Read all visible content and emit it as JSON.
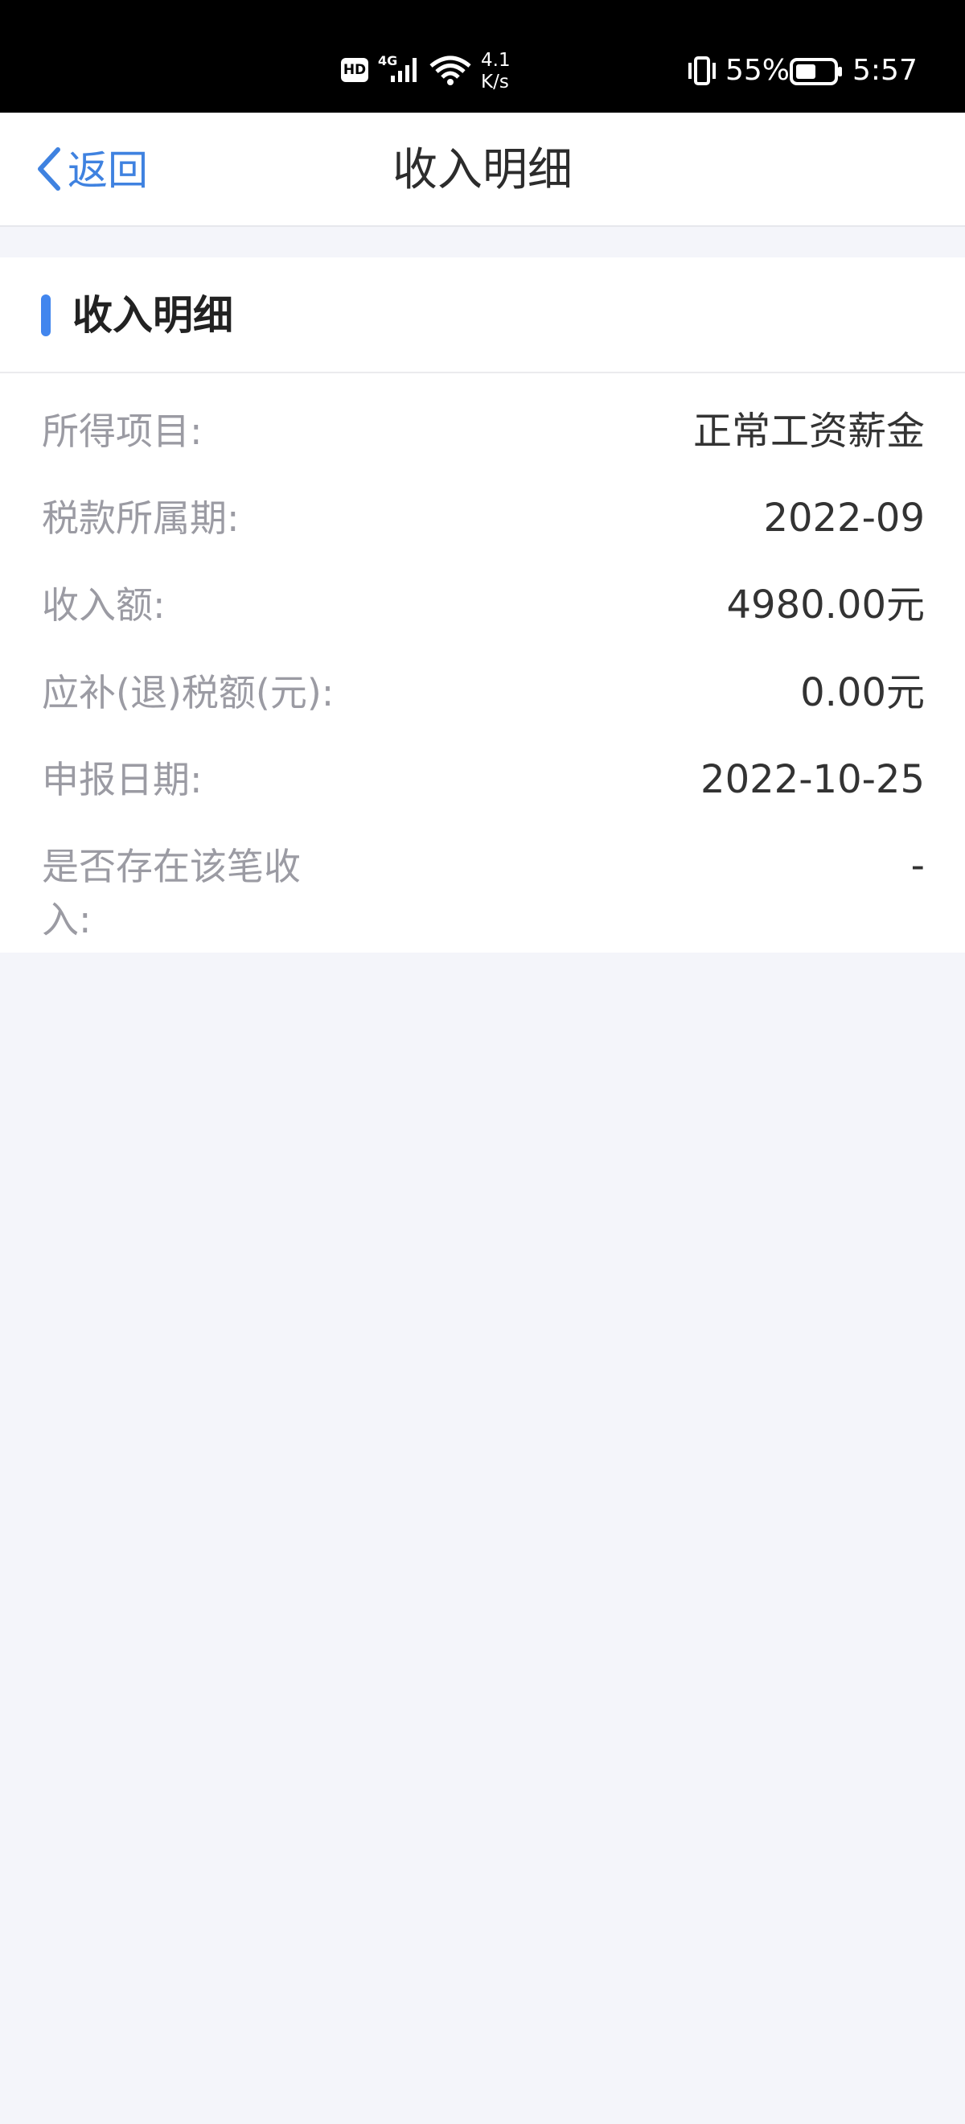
{
  "status_bar": {
    "hd": "HD",
    "network": "4G",
    "speed_line1": "4.1",
    "speed_line2": "K/s",
    "battery_percent": "55%",
    "time": "5:57",
    "battery_level": 0.55
  },
  "nav": {
    "back_label": "返回",
    "title": "收入明细"
  },
  "section": {
    "title": "收入明细",
    "rows": [
      {
        "label": "所得项目:",
        "value": "正常工资薪金"
      },
      {
        "label": "税款所属期:",
        "value": "2022-09"
      },
      {
        "label": "收入额:",
        "value": "4980.00元"
      },
      {
        "label": "应补(退)税额(元):",
        "value": "0.00元"
      },
      {
        "label": "申报日期:",
        "value": "2022-10-25"
      },
      {
        "label": "是否存在该笔收入:",
        "value": "-"
      }
    ]
  },
  "colors": {
    "accent": "#4286ee",
    "link": "#3f82e0",
    "background": "#f4f5fa"
  }
}
